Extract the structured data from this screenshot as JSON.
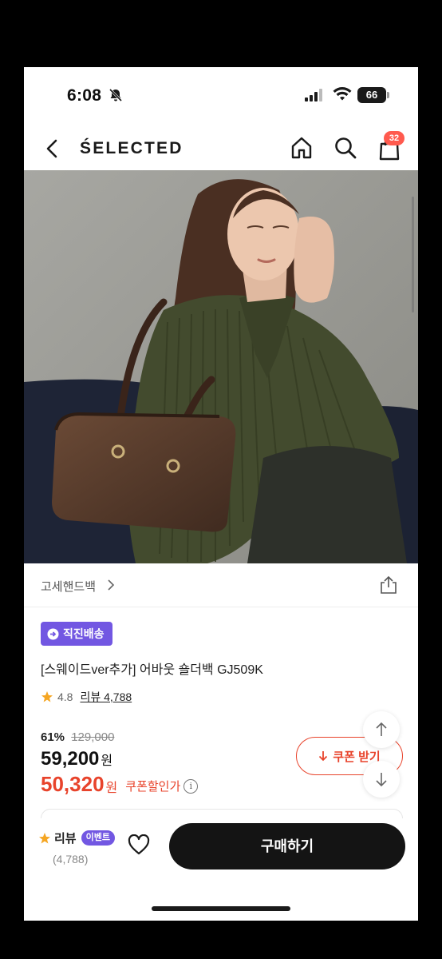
{
  "status_bar": {
    "time": "6:08",
    "battery": "66"
  },
  "header": {
    "logo": "ŚELECTED",
    "cart_count": "32"
  },
  "product_image": {
    "total_images": 7,
    "active_index": 0
  },
  "category": {
    "label": "고세핸드백"
  },
  "badge": {
    "direct_shipping": "직진배송"
  },
  "product": {
    "title": "[스웨이드ver추가] 어바웃 숄더백 GJ509K",
    "rating": "4.8",
    "review_link": "리뷰 4,788"
  },
  "pricing": {
    "discount_pct": "61%",
    "original_price": "129,000",
    "sale_price": "59,200",
    "currency": "원",
    "coupon_price": "50,320",
    "coupon_price_label": "쿠폰할인가",
    "coupon_button": "쿠폰 받기"
  },
  "bottom_bar": {
    "review_label": "리뷰",
    "event_badge": "이벤트",
    "review_count": "(4,788)",
    "buy_button": "구매하기"
  },
  "colors": {
    "accent_purple": "#7257e2",
    "coupon_red": "#e8432b",
    "cart_badge": "#ff5a4e",
    "buy_button": "#141414"
  }
}
